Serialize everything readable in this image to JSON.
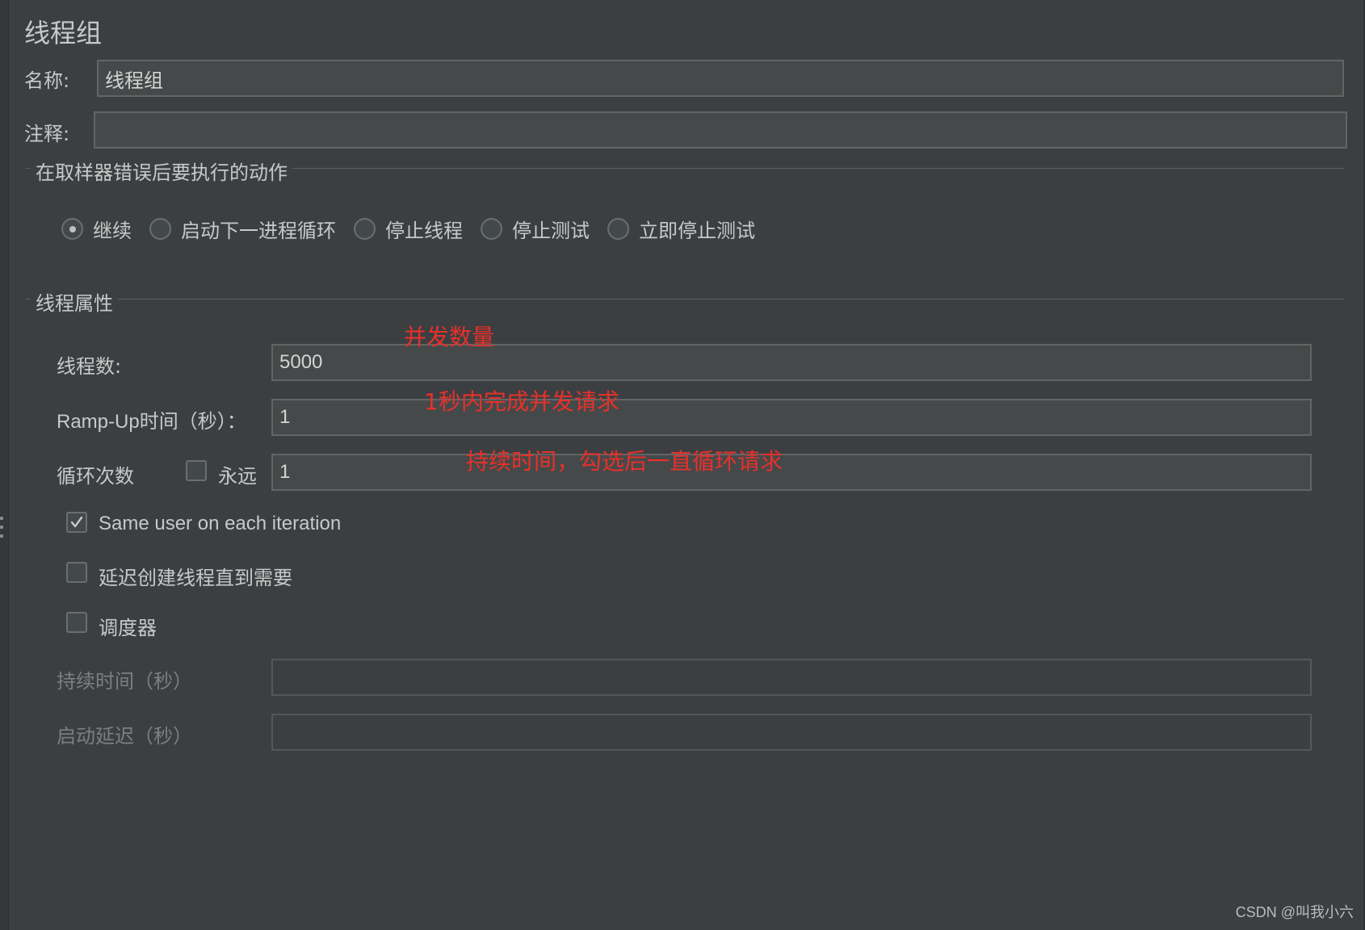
{
  "page": {
    "title": "线程组"
  },
  "name_row": {
    "label": "名称:",
    "value": "线程组"
  },
  "comment_row": {
    "label": "注释:",
    "value": ""
  },
  "error_action_group": {
    "title": "在取样器错误后要执行的动作",
    "selected_index": 0,
    "options": [
      "继续",
      "启动下一进程循环",
      "停止线程",
      "停止测试",
      "立即停止测试"
    ]
  },
  "thread_props_group": {
    "title": "线程属性",
    "threads_label": "线程数:",
    "threads_value": "5000",
    "rampup_label": "Ramp-Up时间（秒）：",
    "rampup_value": "1",
    "loop_label": "循环次数",
    "forever_label": "永远",
    "forever_checked": false,
    "loop_value": "1",
    "same_user_label": "Same user on each iteration",
    "same_user_checked": true,
    "delay_create_label": "延迟创建线程直到需要",
    "delay_create_checked": false,
    "scheduler_label": "调度器",
    "scheduler_checked": false,
    "duration_label": "持续时间（秒）",
    "duration_value": "",
    "startup_delay_label": "启动延迟（秒）",
    "startup_delay_value": ""
  },
  "annotations": {
    "concurrency": "并发数量",
    "rampup_note": "1秒内完成并发请求",
    "loop_note": "持续时间，勾选后一直循环请求"
  },
  "watermark": "CSDN @叫我小六",
  "colors": {
    "background": "#3c3f41",
    "field_bg": "#45494a",
    "annotation_red": "#e8302a"
  }
}
